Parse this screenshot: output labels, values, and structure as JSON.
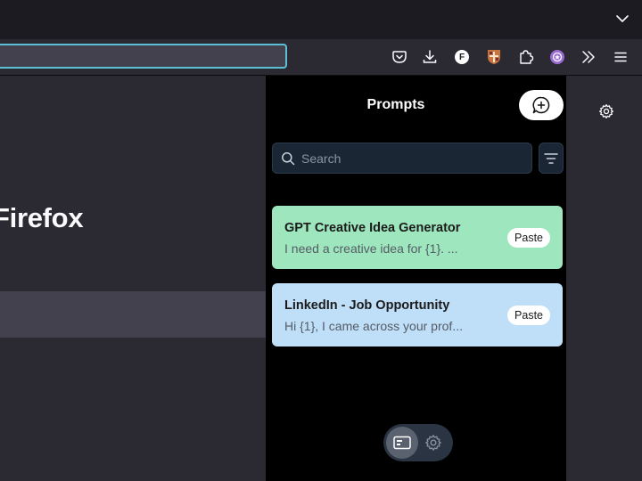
{
  "browser": {
    "page_heading": "Firefox",
    "toolbar_avatar_letter": "F"
  },
  "panel": {
    "title": "Prompts",
    "search_placeholder": "Search",
    "prompts": [
      {
        "title": "GPT Creative Idea Generator",
        "preview": "I need a creative idea for {1}. ...",
        "action": "Paste",
        "color": "#9ee6bd"
      },
      {
        "title": "LinkedIn - Job Opportunity",
        "preview": "Hi {1}, I came across your prof...",
        "action": "Paste",
        "color": "#bfdef7"
      }
    ]
  },
  "icons": {
    "tabs_menu": "chevron-down-icon",
    "pocket": "pocket-icon",
    "downloads": "download-icon",
    "account": "account-avatar-icon",
    "extension_shield": "shield-extension-icon",
    "extensions": "puzzle-icon",
    "prompts_extension": "prompts-extension-icon",
    "overflow": "double-chevron-icon",
    "menu": "hamburger-menu-icon",
    "new_prompt": "add-chat-icon",
    "search": "search-icon",
    "filter": "filter-icon",
    "sidebar_view": "sidebar-view-icon",
    "settings": "gear-icon"
  }
}
